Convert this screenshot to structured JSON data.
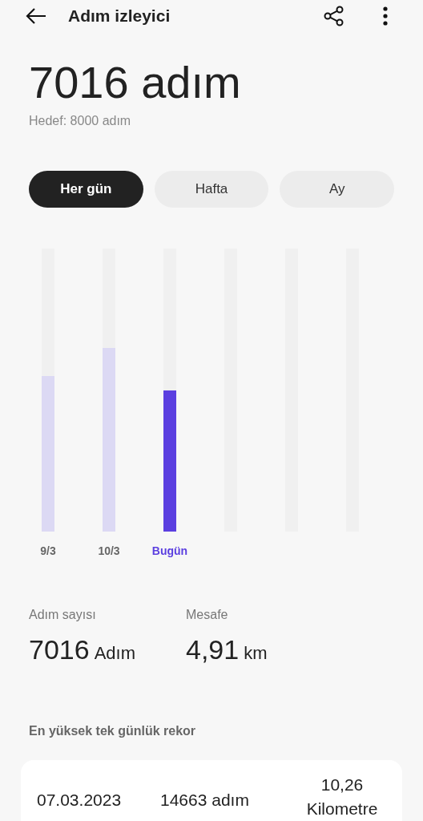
{
  "header": {
    "title": "Adım izleyici"
  },
  "total": {
    "value": "7016 adım",
    "goal": "Hedef: 8000 adım"
  },
  "tabs": [
    {
      "label": "Her gün",
      "selected": true
    },
    {
      "label": "Hafta",
      "selected": false
    },
    {
      "label": "Ay",
      "selected": false
    }
  ],
  "days": [
    {
      "label": "9/3",
      "level": 0.55,
      "selected": false
    },
    {
      "label": "10/3",
      "level": 0.65,
      "selected": false
    },
    {
      "label": "Bugün",
      "level": 0.5,
      "selected": true
    }
  ],
  "stats": [
    {
      "label": "Adım sayısı",
      "value": "7016",
      "unit": "Adım"
    },
    {
      "label": "Mesafe",
      "value": "4,91",
      "unit": "km"
    }
  ],
  "record": {
    "title": "En yüksek tek günlük rekor",
    "date": "07.03.2023",
    "steps": "14663 adım",
    "distance": "10,26 Kilometre"
  }
}
